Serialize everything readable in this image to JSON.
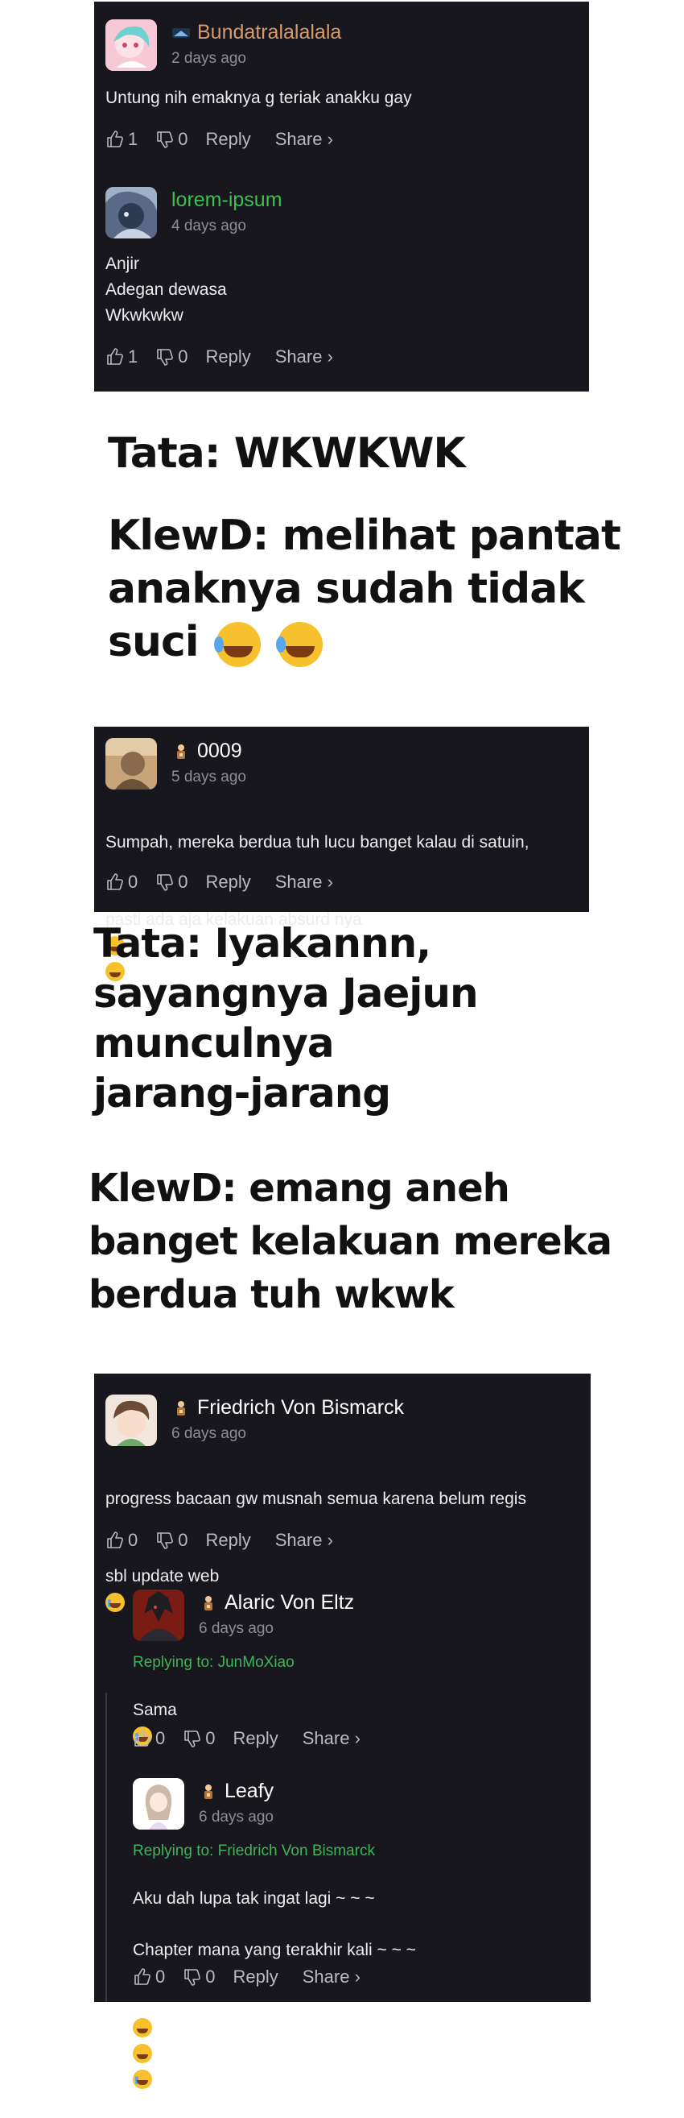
{
  "panel1": {
    "comments": [
      {
        "username": "Bundatralalalala",
        "time": "2 days ago",
        "text": "Untung nih emaknya g teriak anakku gay",
        "likes": "1",
        "dislikes": "0",
        "reply": "Reply",
        "share": "Share ›",
        "name_color": "#d99a6c"
      },
      {
        "username": "lorem-ipsum",
        "time": "4 days ago",
        "text": "Anjir\nAdegan dewasa\nWkwkwkw",
        "likes": "1",
        "dislikes": "0",
        "reply": "Reply",
        "share": "Share ›",
        "name_color": "#3fbf4f"
      }
    ]
  },
  "caption1": {
    "line1": "Tata: WKWKWK",
    "line2": "KlewD: melihat pantat",
    "line3": "anaknya sudah tidak",
    "line4": "suci"
  },
  "panel2": {
    "username": "0009",
    "time": "5 days ago",
    "text_line1": "Sumpah, mereka berdua tuh lucu banget kalau di satuin,",
    "text_line2": "pasti ada aja kelakuan absurd nya",
    "likes": "0",
    "dislikes": "0",
    "reply": "Reply",
    "share": "Share ›"
  },
  "caption2": {
    "line1": "Tata: Iyakannn,",
    "line2": "sayangnya Jaejun",
    "line3": "munculnya",
    "line4": "jarang-jarang",
    "line5": "KlewD: emang aneh",
    "line6": "banget kelakuan mereka",
    "line7": "berdua tuh wkwk"
  },
  "panel3": {
    "main": {
      "username": "Friedrich Von Bismarck",
      "time": "6 days ago",
      "text_line1": "progress bacaan gw musnah semua karena belum regis",
      "text_line2": "sbl update web",
      "likes": "0",
      "dislikes": "0",
      "reply": "Reply",
      "share": "Share ›"
    },
    "replies": [
      {
        "username": "Alaric Von Eltz",
        "time": "6 days ago",
        "replying_to": "Replying to: JunMoXiao",
        "text": "Sama",
        "likes": "0",
        "dislikes": "0",
        "reply": "Reply",
        "share": "Share ›"
      },
      {
        "username": "Leafy",
        "time": "6 days ago",
        "replying_to": "Replying to: Friedrich Von Bismarck",
        "text_line1": "Aku dah lupa tak ingat lagi ~ ~ ~",
        "text_line2": "Chapter mana yang terakhir kali ~ ~ ~",
        "likes": "0",
        "dislikes": "0",
        "reply": "Reply",
        "share": "Share ›"
      }
    ]
  },
  "colors": {
    "panel_bg": "#17171d",
    "reply_green": "#3fb45a",
    "muted_text": "#8e8e96",
    "action_text": "#b9b9c0"
  },
  "icons": [
    "thumb-up-icon",
    "thumb-down-icon",
    "badge-icon",
    "rolling-laugh-emoji",
    "crying-emoji"
  ]
}
